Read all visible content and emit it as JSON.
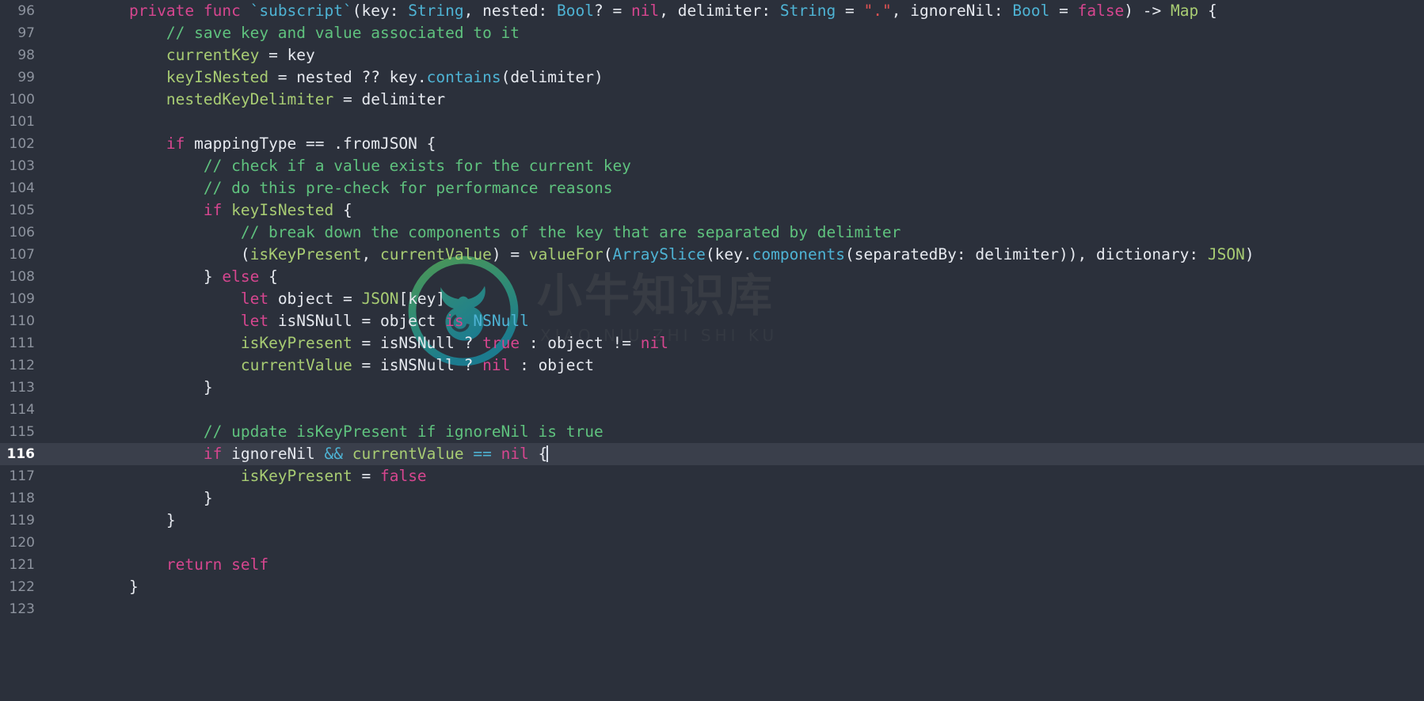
{
  "editor": {
    "theme_background": "#2b303b",
    "active_line_background": "#3a3f4b",
    "gutter_color": "#8d939e",
    "active_line_number": 116,
    "first_line": 96,
    "last_line": 123,
    "language": "Swift",
    "cursor": {
      "line": 116,
      "column": 31
    }
  },
  "watermark": {
    "logo_name": "bull-head-logo",
    "text": "小牛知识库",
    "subtext": "XIAO NIU ZHI SHI KU",
    "logo_color_outer": "#3f8f5a",
    "logo_color_inner": "#1e7f8a"
  },
  "lines": [
    {
      "number": "96",
      "tokens": [
        {
          "t": "    ",
          "c": "t-plain"
        },
        {
          "t": "private func ",
          "c": "t-kw2"
        },
        {
          "t": "`subscript`",
          "c": "t-type"
        },
        {
          "t": "(key: ",
          "c": "t-plain"
        },
        {
          "t": "String",
          "c": "t-type"
        },
        {
          "t": ", nested: ",
          "c": "t-plain"
        },
        {
          "t": "Bool",
          "c": "t-type"
        },
        {
          "t": "? = ",
          "c": "t-plain"
        },
        {
          "t": "nil",
          "c": "t-nil"
        },
        {
          "t": ", delimiter: ",
          "c": "t-plain"
        },
        {
          "t": "String",
          "c": "t-type"
        },
        {
          "t": " = ",
          "c": "t-plain"
        },
        {
          "t": "\".\"",
          "c": "t-str"
        },
        {
          "t": ", ignoreNil: ",
          "c": "t-plain"
        },
        {
          "t": "Bool",
          "c": "t-type"
        },
        {
          "t": " = ",
          "c": "t-plain"
        },
        {
          "t": "false",
          "c": "t-nil"
        },
        {
          "t": ") -> ",
          "c": "t-plain"
        },
        {
          "t": "Map",
          "c": "t-type2"
        },
        {
          "t": " {",
          "c": "t-plain"
        }
      ]
    },
    {
      "number": "97",
      "tokens": [
        {
          "t": "        // save key and value associated to it",
          "c": "t-comment"
        }
      ]
    },
    {
      "number": "98",
      "tokens": [
        {
          "t": "        ",
          "c": "t-plain"
        },
        {
          "t": "currentKey",
          "c": "t-ident"
        },
        {
          "t": " = ",
          "c": "t-plain"
        },
        {
          "t": "key",
          "c": "t-plain"
        }
      ]
    },
    {
      "number": "99",
      "tokens": [
        {
          "t": "        ",
          "c": "t-plain"
        },
        {
          "t": "keyIsNested",
          "c": "t-ident"
        },
        {
          "t": " = nested ?? key.",
          "c": "t-plain"
        },
        {
          "t": "contains",
          "c": "t-fn"
        },
        {
          "t": "(delimiter)",
          "c": "t-plain"
        }
      ]
    },
    {
      "number": "100",
      "tokens": [
        {
          "t": "        ",
          "c": "t-plain"
        },
        {
          "t": "nestedKeyDelimiter",
          "c": "t-ident"
        },
        {
          "t": " = delimiter",
          "c": "t-plain"
        }
      ]
    },
    {
      "number": "101",
      "tokens": []
    },
    {
      "number": "102",
      "tokens": [
        {
          "t": "        ",
          "c": "t-plain"
        },
        {
          "t": "if",
          "c": "t-kw2"
        },
        {
          "t": " mappingType ",
          "c": "t-plain"
        },
        {
          "t": "==",
          "c": "t-plain"
        },
        {
          "t": " .fromJSON {",
          "c": "t-plain"
        }
      ]
    },
    {
      "number": "103",
      "tokens": [
        {
          "t": "            // check if a value exists for the current key",
          "c": "t-comment"
        }
      ]
    },
    {
      "number": "104",
      "tokens": [
        {
          "t": "            // do this pre-check for performance reasons",
          "c": "t-comment"
        }
      ]
    },
    {
      "number": "105",
      "tokens": [
        {
          "t": "            ",
          "c": "t-plain"
        },
        {
          "t": "if",
          "c": "t-kw2"
        },
        {
          "t": " ",
          "c": "t-plain"
        },
        {
          "t": "keyIsNested",
          "c": "t-ident"
        },
        {
          "t": " {",
          "c": "t-plain"
        }
      ]
    },
    {
      "number": "106",
      "tokens": [
        {
          "t": "                // break down the components of the key that are separated by delimiter",
          "c": "t-comment"
        }
      ]
    },
    {
      "number": "107",
      "tokens": [
        {
          "t": "                (",
          "c": "t-plain"
        },
        {
          "t": "isKeyPresent",
          "c": "t-ident"
        },
        {
          "t": ", ",
          "c": "t-plain"
        },
        {
          "t": "currentValue",
          "c": "t-ident"
        },
        {
          "t": ") = ",
          "c": "t-plain"
        },
        {
          "t": "valueFor",
          "c": "t-ident"
        },
        {
          "t": "(",
          "c": "t-plain"
        },
        {
          "t": "ArraySlice",
          "c": "t-type"
        },
        {
          "t": "(key.",
          "c": "t-plain"
        },
        {
          "t": "components",
          "c": "t-fn"
        },
        {
          "t": "(separatedBy: delimiter)), dictionary: ",
          "c": "t-plain"
        },
        {
          "t": "JSON",
          "c": "t-type2"
        },
        {
          "t": ")",
          "c": "t-plain"
        }
      ]
    },
    {
      "number": "108",
      "tokens": [
        {
          "t": "            } ",
          "c": "t-plain"
        },
        {
          "t": "else",
          "c": "t-kw2"
        },
        {
          "t": " {",
          "c": "t-plain"
        }
      ]
    },
    {
      "number": "109",
      "tokens": [
        {
          "t": "                ",
          "c": "t-plain"
        },
        {
          "t": "let",
          "c": "t-kw2"
        },
        {
          "t": " object = ",
          "c": "t-plain"
        },
        {
          "t": "JSON",
          "c": "t-type2"
        },
        {
          "t": "[key]",
          "c": "t-plain"
        }
      ]
    },
    {
      "number": "110",
      "tokens": [
        {
          "t": "                ",
          "c": "t-plain"
        },
        {
          "t": "let",
          "c": "t-kw2"
        },
        {
          "t": " isNSNull = object ",
          "c": "t-plain"
        },
        {
          "t": "is",
          "c": "t-kw2"
        },
        {
          "t": " ",
          "c": "t-plain"
        },
        {
          "t": "NSNull",
          "c": "t-type"
        }
      ]
    },
    {
      "number": "111",
      "tokens": [
        {
          "t": "                ",
          "c": "t-plain"
        },
        {
          "t": "isKeyPresent",
          "c": "t-ident"
        },
        {
          "t": " = isNSNull ? ",
          "c": "t-plain"
        },
        {
          "t": "true",
          "c": "t-nil"
        },
        {
          "t": " : object ",
          "c": "t-plain"
        },
        {
          "t": "!=",
          "c": "t-plain"
        },
        {
          "t": " ",
          "c": "t-plain"
        },
        {
          "t": "nil",
          "c": "t-nil"
        }
      ]
    },
    {
      "number": "112",
      "tokens": [
        {
          "t": "                ",
          "c": "t-plain"
        },
        {
          "t": "currentValue",
          "c": "t-ident"
        },
        {
          "t": " = isNSNull ? ",
          "c": "t-plain"
        },
        {
          "t": "nil",
          "c": "t-nil"
        },
        {
          "t": " : object",
          "c": "t-plain"
        }
      ]
    },
    {
      "number": "113",
      "tokens": [
        {
          "t": "            }",
          "c": "t-plain"
        }
      ]
    },
    {
      "number": "114",
      "tokens": []
    },
    {
      "number": "115",
      "tokens": [
        {
          "t": "            // update isKeyPresent if ignoreNil is true",
          "c": "t-comment"
        }
      ]
    },
    {
      "number": "116",
      "active": true,
      "cursor_after": true,
      "tokens": [
        {
          "t": "            ",
          "c": "t-plain"
        },
        {
          "t": "if",
          "c": "t-kw2"
        },
        {
          "t": " ignoreNil ",
          "c": "t-plain"
        },
        {
          "t": "&&",
          "c": "t-op"
        },
        {
          "t": " ",
          "c": "t-plain"
        },
        {
          "t": "currentValue",
          "c": "t-ident"
        },
        {
          "t": " ",
          "c": "t-plain"
        },
        {
          "t": "==",
          "c": "t-op"
        },
        {
          "t": " ",
          "c": "t-plain"
        },
        {
          "t": "nil",
          "c": "t-nil"
        },
        {
          "t": " {",
          "c": "t-plain"
        }
      ]
    },
    {
      "number": "117",
      "tokens": [
        {
          "t": "                ",
          "c": "t-plain"
        },
        {
          "t": "isKeyPresent",
          "c": "t-ident"
        },
        {
          "t": " = ",
          "c": "t-plain"
        },
        {
          "t": "false",
          "c": "t-nil"
        }
      ]
    },
    {
      "number": "118",
      "tokens": [
        {
          "t": "            }",
          "c": "t-plain"
        }
      ]
    },
    {
      "number": "119",
      "tokens": [
        {
          "t": "        }",
          "c": "t-plain"
        }
      ]
    },
    {
      "number": "120",
      "tokens": []
    },
    {
      "number": "121",
      "tokens": [
        {
          "t": "        ",
          "c": "t-plain"
        },
        {
          "t": "return self",
          "c": "t-kw2"
        }
      ]
    },
    {
      "number": "122",
      "tokens": [
        {
          "t": "    }",
          "c": "t-plain"
        }
      ]
    },
    {
      "number": "123",
      "tokens": []
    }
  ]
}
